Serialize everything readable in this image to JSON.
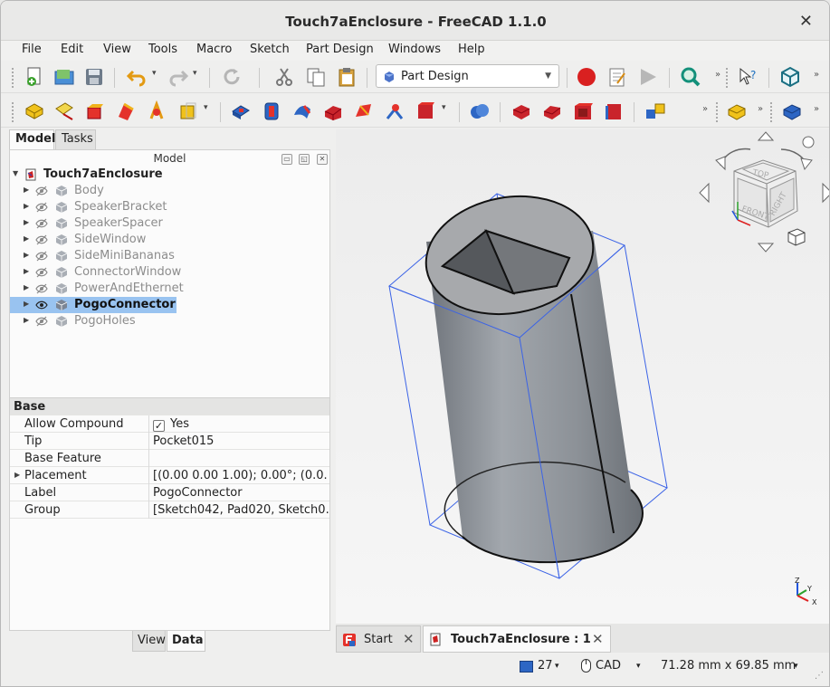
{
  "window": {
    "title": "Touch7aEnclosure - FreeCAD 1.1.0",
    "close_glyph": "✕"
  },
  "menu": [
    "File",
    "Edit",
    "View",
    "Tools",
    "Macro",
    "Sketch",
    "Part Design",
    "Windows",
    "Help"
  ],
  "toolbar": {
    "workbench_selected": "Part Design",
    "overflow_glyph": "»"
  },
  "left_panel": {
    "tabs": [
      "Model",
      "Tasks"
    ],
    "active_tab": "Model",
    "tree_header": "Model",
    "tree": {
      "root": "Touch7aEnclosure",
      "items": [
        {
          "label": "Body",
          "visible": false,
          "selected": false
        },
        {
          "label": "SpeakerBracket",
          "visible": false,
          "selected": false
        },
        {
          "label": "SpeakerSpacer",
          "visible": false,
          "selected": false
        },
        {
          "label": "SideWindow",
          "visible": false,
          "selected": false
        },
        {
          "label": "SideMiniBananas",
          "visible": false,
          "selected": false
        },
        {
          "label": "ConnectorWindow",
          "visible": false,
          "selected": false
        },
        {
          "label": "PowerAndEthernet",
          "visible": false,
          "selected": false
        },
        {
          "label": "PogoConnector",
          "visible": true,
          "selected": true
        },
        {
          "label": "PogoHoles",
          "visible": false,
          "selected": false
        }
      ]
    },
    "properties": {
      "group": "Base",
      "rows": [
        {
          "name": "Allow Compound",
          "value": "Yes",
          "checkbox": true
        },
        {
          "name": "Tip",
          "value": "Pocket015"
        },
        {
          "name": "Base Feature",
          "value": ""
        },
        {
          "name": "Placement",
          "value": "[(0.00 0.00 1.00); 0.00°; (0.0...",
          "expandable": true
        },
        {
          "name": "Label",
          "value": "PogoConnector"
        },
        {
          "name": "Group",
          "value": "[Sketch042, Pad020, Sketch0..."
        }
      ]
    },
    "bottom_tabs": [
      "View",
      "Data"
    ],
    "active_bottom_tab": "Data"
  },
  "navcube": {
    "faces": [
      "TOP",
      "FRONT",
      "RIGHT"
    ]
  },
  "axis_labels": {
    "x": "X",
    "y": "Y",
    "z": "Z"
  },
  "doc_tabs": [
    {
      "label": "Start",
      "active": false
    },
    {
      "label": "Touch7aEnclosure : 1",
      "active": true
    }
  ],
  "status": {
    "render_count": "27",
    "nav_style": "CAD",
    "dimensions": "71.28 mm x 69.85 mm"
  },
  "colors": {
    "selection": "#99c3f0",
    "bounding_box": "#3b63e6",
    "record_button": "#d92020"
  }
}
